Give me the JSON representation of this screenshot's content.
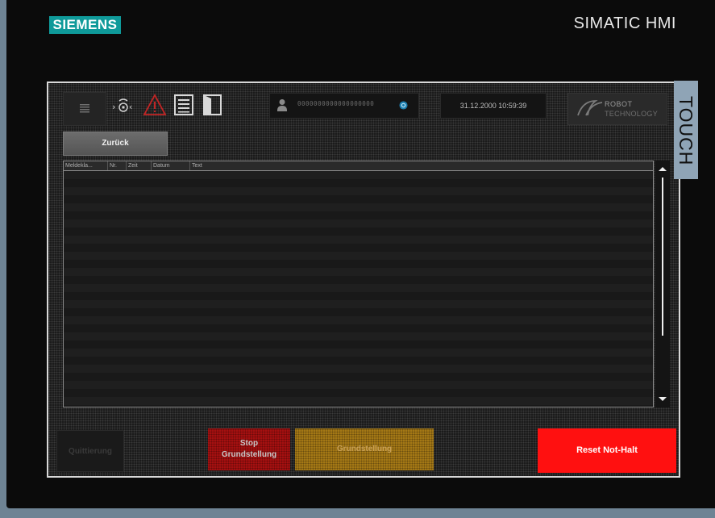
{
  "device": {
    "brand": "SIEMENS",
    "model": "SIMATIC HMI",
    "side_label": "TOUCH",
    "colors": {
      "brand": "#0f9a9a",
      "frame": "#6e8394"
    }
  },
  "topbar": {
    "icons": [
      "menu-icon",
      "operator-face-icon",
      "warning-triangle-icon",
      "message-list-icon",
      "door-icon"
    ],
    "user_field": "0000000000000000000",
    "datetime": "31.12.2000 10:59:39",
    "logo": {
      "line1": "ROBOT",
      "line2": "TECHNOLOGY"
    }
  },
  "nav": {
    "back_label": "Zurück"
  },
  "alarm_table": {
    "columns": [
      "Meldekla...",
      "Nr.",
      "Zeit",
      "Datum",
      "Text"
    ],
    "rows": []
  },
  "bottombar": {
    "quittierung_label": "Quittierung",
    "stop_label_line1": "Stop",
    "stop_label_line2": "Grundstellung",
    "grundstellung_label": "Grundstellung",
    "reset_label": "Reset Not-Halt",
    "colors": {
      "stop": "#a51010",
      "grundstellung": "#a47815",
      "reset": "#ff1010"
    }
  }
}
